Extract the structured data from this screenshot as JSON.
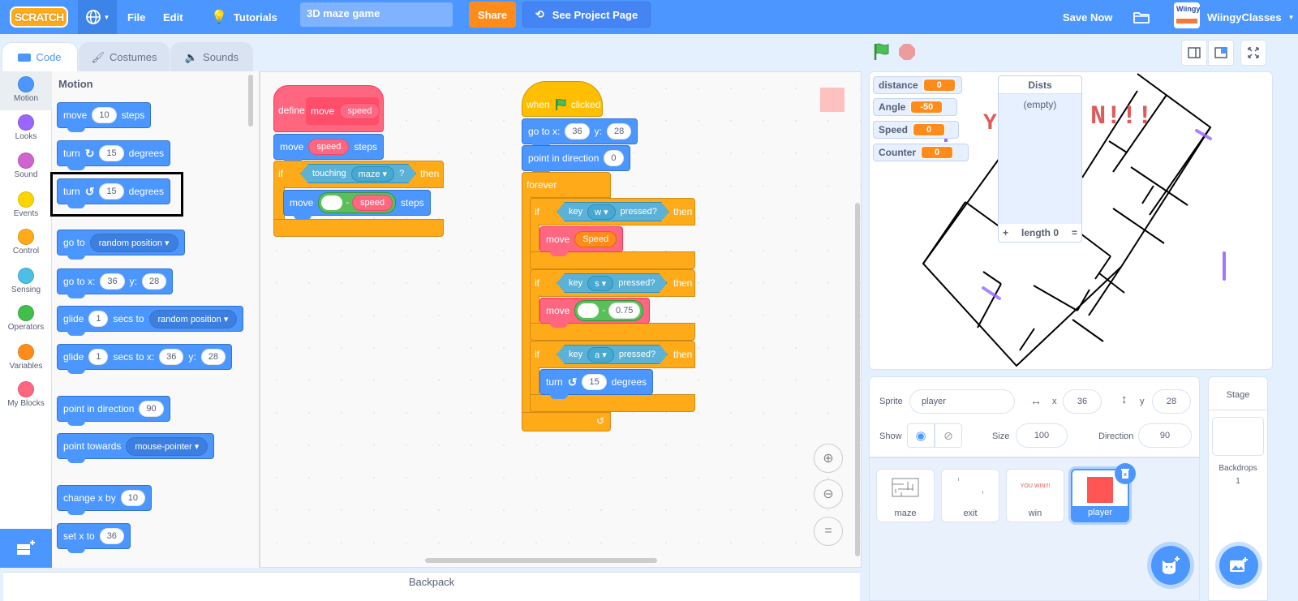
{
  "menubar": {
    "logo": "SCRATCH",
    "language_icon": "globe-icon",
    "file": "File",
    "edit": "Edit",
    "tutorials": "Tutorials",
    "project_title": "3D maze game",
    "share": "Share",
    "see_project_page": "See Project Page",
    "save_now": "Save Now",
    "username": "WiingyClasses",
    "avatar_text": "Wiingy"
  },
  "tabs": [
    {
      "label": "Code",
      "icon": "code-icon",
      "active": true
    },
    {
      "label": "Costumes",
      "icon": "brush-icon",
      "active": false
    },
    {
      "label": "Sounds",
      "icon": "speaker-icon",
      "active": false
    }
  ],
  "categories": [
    {
      "label": "Motion",
      "color": "#4c97ff"
    },
    {
      "label": "Looks",
      "color": "#9966ff"
    },
    {
      "label": "Sound",
      "color": "#cf63cf"
    },
    {
      "label": "Events",
      "color": "#ffd500"
    },
    {
      "label": "Control",
      "color": "#ffab19"
    },
    {
      "label": "Sensing",
      "color": "#4cbfe6"
    },
    {
      "label": "Operators",
      "color": "#40bf4a"
    },
    {
      "label": "Variables",
      "color": "#ff8c1a"
    },
    {
      "label": "My Blocks",
      "color": "#ff6680"
    }
  ],
  "palette": {
    "title": "Motion",
    "blocks": {
      "move": {
        "a": "move",
        "v": "10",
        "b": "steps"
      },
      "turn_right": {
        "a": "turn",
        "v": "15",
        "b": "degrees"
      },
      "turn_left": {
        "a": "turn",
        "v": "15",
        "b": "degrees"
      },
      "goto": {
        "a": "go to",
        "dd": "random position"
      },
      "goto_xy": {
        "a": "go to x:",
        "x": "36",
        "b": "y:",
        "y": "28"
      },
      "glide": {
        "a": "glide",
        "v": "1",
        "b": "secs to",
        "dd": "random position"
      },
      "glide_xy": {
        "a": "glide",
        "v": "1",
        "b": "secs to x:",
        "x": "36",
        "c": "y:",
        "y": "28"
      },
      "point_dir": {
        "a": "point in direction",
        "v": "90"
      },
      "point_towards": {
        "a": "point towards",
        "dd": "mouse-pointer"
      },
      "change_x": {
        "a": "change x by",
        "v": "10"
      },
      "set_x": {
        "a": "set x to",
        "v": "36"
      }
    }
  },
  "script1": {
    "define": "define",
    "proc_name": "move",
    "proc_arg": "speed",
    "move": "move",
    "move_arg": "speed",
    "steps": "steps",
    "if": "if",
    "touching": "touching",
    "touching_dd": "maze",
    "q": "?",
    "then": "then",
    "move2": "move",
    "minus": "-",
    "move2_arg": "speed",
    "steps2": "steps"
  },
  "script2": {
    "when": "when",
    "clicked": "clicked",
    "goto": "go to x:",
    "x": "36",
    "y_lbl": "y:",
    "y": "28",
    "point": "point in direction",
    "dir": "0",
    "forever": "forever",
    "if": "if",
    "key": "key",
    "pressed": "pressed?",
    "then": "then",
    "key_w": "w",
    "move": "move",
    "speed_var": "Speed",
    "key_s": "s",
    "minus": "-",
    "back_val": "0.75",
    "key_a": "a",
    "turn": "turn",
    "turn_val": "15",
    "degrees": "degrees"
  },
  "script_area": {
    "zoom_in": "zoom-in",
    "zoom_out": "zoom-out",
    "zoom_reset": "="
  },
  "backpack": "Backpack",
  "stage": {
    "monitors": [
      {
        "label": "distance",
        "value": "0"
      },
      {
        "label": "Angle",
        "value": "-50"
      },
      {
        "label": "Speed",
        "value": "0"
      },
      {
        "label": "Counter",
        "value": "0"
      }
    ],
    "list_monitor": {
      "title": "Dists",
      "empty": "(empty)",
      "add": "+",
      "length": "length 0",
      "resize": "="
    },
    "win_text_fragment": "N!!!"
  },
  "sprite_info": {
    "sprite_label": "Sprite",
    "sprite_name": "player",
    "x_label": "x",
    "x": "36",
    "y_label": "y",
    "y": "28",
    "show_label": "Show",
    "size_label": "Size",
    "size": "100",
    "direction_label": "Direction",
    "direction": "90"
  },
  "sprites": [
    {
      "name": "maze",
      "selected": false
    },
    {
      "name": "exit",
      "selected": false
    },
    {
      "name": "win",
      "selected": false,
      "thumb_text": "YOU WIN!!!"
    },
    {
      "name": "player",
      "selected": true
    }
  ],
  "stage_pane": {
    "title": "Stage",
    "backdrops_label": "Backdrops",
    "backdrops_count": "1"
  }
}
